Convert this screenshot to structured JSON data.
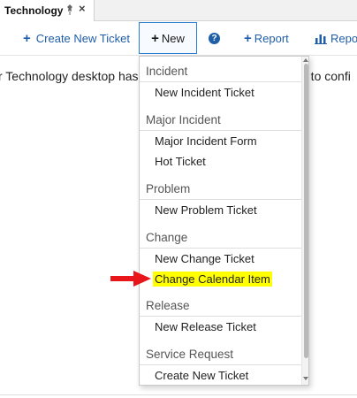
{
  "tab": {
    "title": "Technology",
    "close_glyph": "×",
    "pin_icon": "pin-icon"
  },
  "toolbar": {
    "create_label": "Create New Ticket",
    "new_label": "New",
    "help_glyph": "?",
    "report_label": "Report",
    "reports_label": "Repor"
  },
  "body": {
    "left_text": "r Technology desktop has",
    "right_text": "e to confi"
  },
  "menu": {
    "groups": [
      {
        "header": "Incident",
        "items": [
          "New Incident Ticket"
        ]
      },
      {
        "header": "Major Incident",
        "items": [
          "Major Incident Form",
          "Hot Ticket"
        ]
      },
      {
        "header": "Problem",
        "items": [
          "New Problem Ticket"
        ]
      },
      {
        "header": "Change",
        "items": [
          "New Change Ticket",
          "Change Calendar Item"
        ]
      },
      {
        "header": "Release",
        "items": [
          "New Release Ticket"
        ]
      },
      {
        "header": "Service Request",
        "items": [
          "Create New Ticket"
        ]
      }
    ],
    "highlighted_item": "Change Calendar Item"
  },
  "colors": {
    "accent": "#1f5ea8",
    "highlight": "#ffff00",
    "arrow": "#e8151b"
  }
}
